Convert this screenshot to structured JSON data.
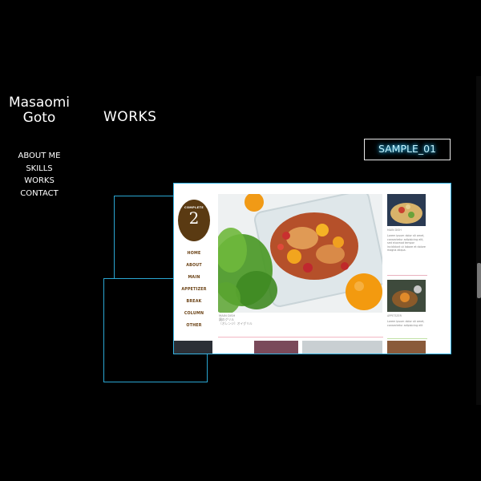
{
  "brand": {
    "name_line1": "Masaomi",
    "name_line2": "Goto"
  },
  "page": {
    "title": "WORKS",
    "sample_label": "SAMPLE_01"
  },
  "nav": {
    "items": [
      {
        "label": "ABOUT ME"
      },
      {
        "label": "SKILLS"
      },
      {
        "label": "WORKS"
      },
      {
        "label": "CONTACT"
      }
    ]
  },
  "preview": {
    "logo_arc": "COMPLETE",
    "logo_number": "2",
    "menu": [
      "HOME",
      "ABOUT",
      "MAIN",
      "APPETIZER",
      "BREAK",
      "COLUMN",
      "OTHER"
    ],
    "hero_meta_line1": "MAIN DISH",
    "hero_meta_line2": "鶏のグリル",
    "hero_meta_line3": "〔オレンジ〕オイグリル",
    "cards": [
      {
        "meta": "MAIN DISH",
        "text": "Lorem ipsum dolor sit amet, consectetur adipisicing elit, sed eiusmod tempor incididunt ut labore et dolore magna aliqua."
      },
      {
        "meta": "APPETIZER",
        "text": "Lorem ipsum dolor sit amet, consectetur adipisicing elit"
      }
    ]
  },
  "colors": {
    "accent": "#2aa6d2",
    "neon": "#3ad0ff",
    "logo_brown": "#5a3a12"
  }
}
